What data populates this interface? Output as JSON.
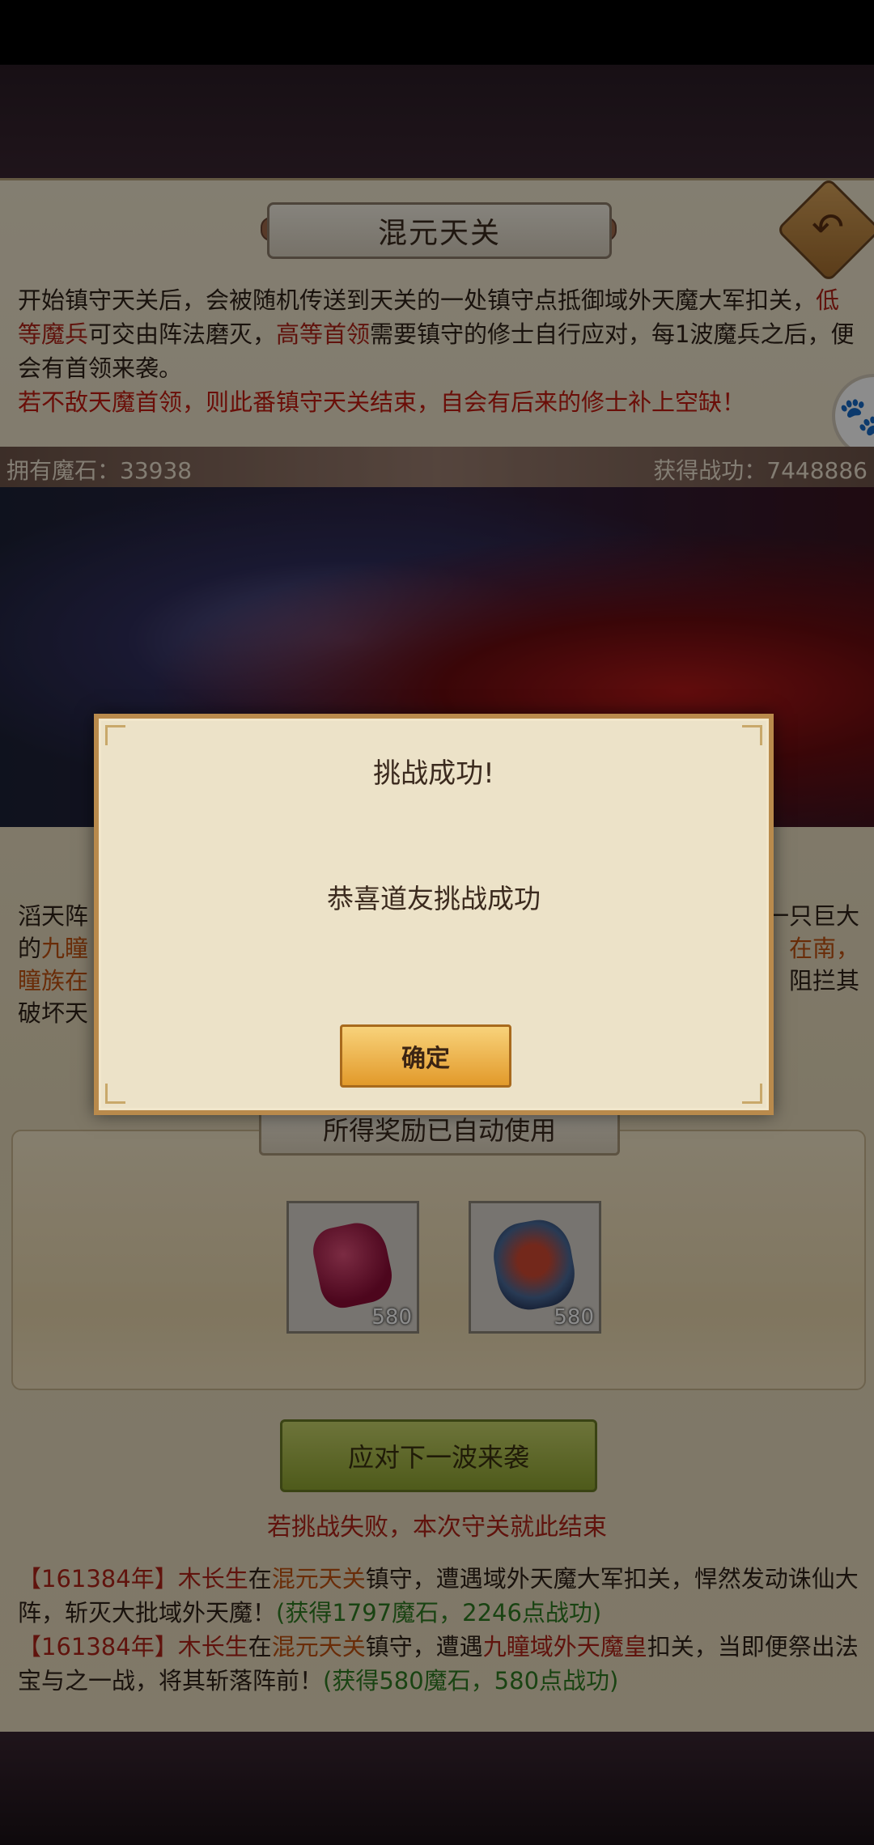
{
  "title": "混元天关",
  "intro": {
    "p1_part1": "开始镇守天关后，会被随机传送到天关的一处镇守点抵御域外天魔大军扣关，",
    "p1_red1": "低等魔兵",
    "p1_part2": "可交由阵法磨灭，",
    "p1_red2": "高等首领",
    "p1_part3": "需要镇守的修士自行应对，每1波魔兵之后，便会有首领来袭。",
    "warning": "若不敌天魔首领，则此番镇守天关结束，自会有后来的修士补上空缺！"
  },
  "resources": {
    "magic_stone": "拥有魔石：33938",
    "merit": "获得战功：7448886"
  },
  "lower": {
    "l1_a": "滔天阵",
    "l1_b": "一只巨大",
    "l2_a": "的",
    "l2_orange_a": "九瞳",
    "l2_orange_b": "在南，",
    "l3_orange_a": "瞳族在",
    "l3_b": "阻拦其",
    "l4_a": "破坏天"
  },
  "rewards": {
    "header": "所得奖励已自动使用",
    "items": [
      {
        "name": "魔石",
        "count": "580"
      },
      {
        "name": "战功令",
        "count": "580"
      }
    ]
  },
  "next_button": "应对下一波来袭",
  "fail_note": "若挑战失败，本次守关就此结束",
  "log": [
    {
      "year": "【161384年】",
      "who": "木长生",
      "at": "在",
      "place": "混元天关",
      "text": "镇守，遭遇域外天魔大军扣关，悍然发动诛仙大阵，斩灭大批域外天魔！",
      "gain": "(获得1797魔石，2246点战功)"
    },
    {
      "year": "【161384年】",
      "who": "木长生",
      "at": "在",
      "place": "混元天关",
      "text1": "镇守，遭遇",
      "enemy": "九瞳域外天魔皇",
      "text2": "扣关，当即便祭出法宝与之一战，将其斩落阵前！",
      "gain": "(获得580魔石，580点战功)"
    }
  ],
  "dialog": {
    "title": "挑战成功!",
    "message": "恭喜道友挑战成功",
    "ok": "确定"
  }
}
